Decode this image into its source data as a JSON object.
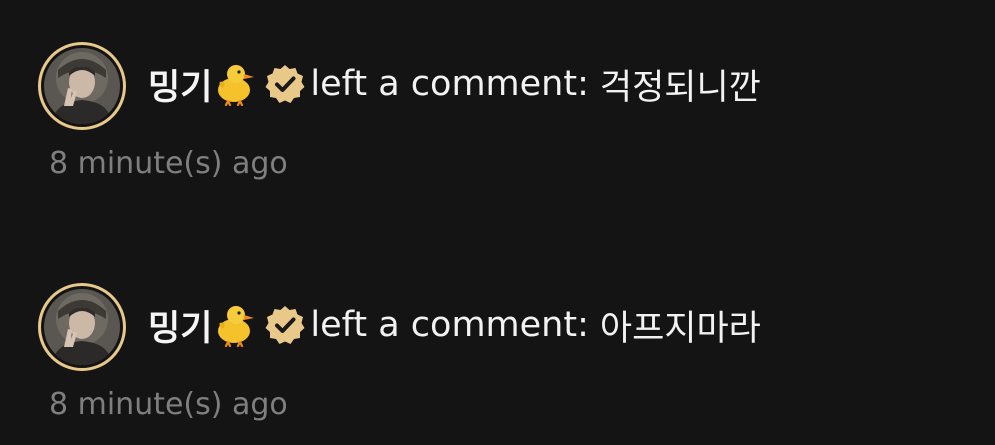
{
  "colors": {
    "background": "#141414",
    "text": "#f2f2f2",
    "muted": "#7f7f7f",
    "badge": "#e8c98a"
  },
  "notifications": [
    {
      "username": "밍기",
      "emoji_icon": "baby-chick-icon",
      "badge_icon": "verified-badge-icon",
      "action": "left a comment:",
      "comment": "걱정되니깐",
      "time": "8 minute(s) ago"
    },
    {
      "username": "밍기",
      "emoji_icon": "baby-chick-icon",
      "badge_icon": "verified-badge-icon",
      "action": "left a comment:",
      "comment": "아프지마라",
      "time": "8 minute(s) ago"
    }
  ]
}
